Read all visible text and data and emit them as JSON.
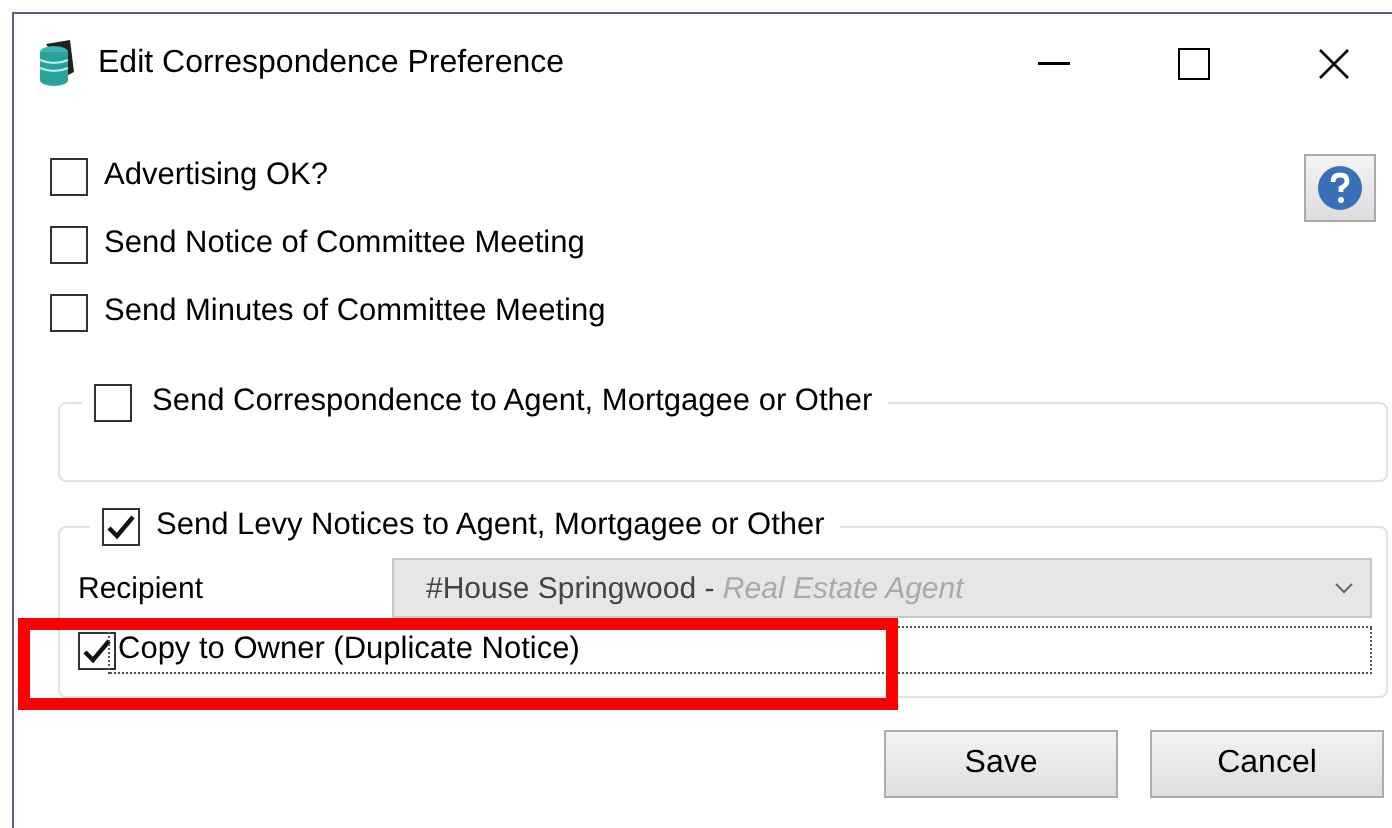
{
  "window": {
    "title": "Edit Correspondence Preference"
  },
  "options": [
    {
      "label": "Advertising OK?",
      "checked": false
    },
    {
      "label": "Send Notice of Committee Meeting",
      "checked": false
    },
    {
      "label": "Send Minutes of Committee Meeting",
      "checked": false
    }
  ],
  "correspondence_group": {
    "label": "Send Correspondence to Agent, Mortgagee or Other",
    "checked": false
  },
  "levy_group": {
    "label": "Send Levy Notices to Agent, Mortgagee or Other",
    "checked": true,
    "recipient": {
      "label": "Recipient",
      "value": "#House Springwood - ",
      "detail": "Real Estate Agent",
      "disabled": true
    },
    "copy_to_owner": {
      "label": "Copy to Owner (Duplicate Notice)",
      "checked": true,
      "focused": true
    }
  },
  "highlight": {
    "kind": "box"
  },
  "buttons": [
    "Save",
    "Cancel"
  ]
}
